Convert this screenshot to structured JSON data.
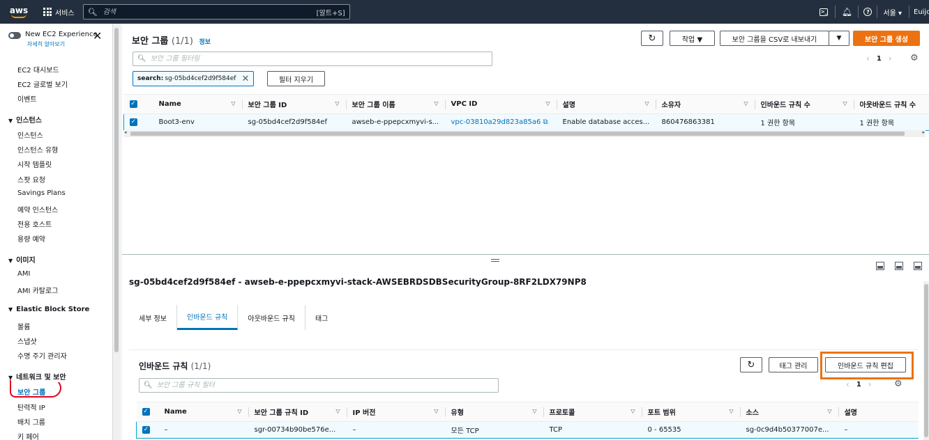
{
  "topnav": {
    "logo": "aws",
    "services": "서비스",
    "search_placeholder": "검색",
    "search_shortcut": "[알트+S]",
    "region": "서울 ▾",
    "user": "Euijo",
    "icons": [
      "cloudshell-icon",
      "bell-icon",
      "help-icon"
    ]
  },
  "sidebar": {
    "new_experience": "New EC2 Experience",
    "learn_more": "자세히 알아보기",
    "items_top": [
      "EC2 대시보드",
      "EC2 글로벌 보기",
      "이벤트"
    ],
    "sections": [
      {
        "title": "인스턴스",
        "items": [
          "인스턴스",
          "인스턴스 유형",
          "시작 템플릿",
          "스팟 요청",
          "Savings Plans",
          "예약 인스턴스",
          "전용 호스트",
          "용량 예약"
        ]
      },
      {
        "title": "이미지",
        "items": [
          "AMI",
          "AMI 카탈로그"
        ]
      },
      {
        "title": "Elastic Block Store",
        "items": [
          "볼륨",
          "스냅샷",
          "수명 주기 관리자"
        ]
      },
      {
        "title": "네트워크 및 보안",
        "items": [
          "보안 그룹",
          "탄력적 IP",
          "배치 그룹",
          "키 페어"
        ]
      }
    ],
    "active_item": "보안 그룹"
  },
  "top_panel": {
    "title": "보안 그룹",
    "count": "(1/1)",
    "info": "정보",
    "buttons": {
      "actions": "작업 ▼",
      "export": "보안 그룹을 CSV로 내보내기",
      "create": "보안 그룹 생성",
      "clear_filter": "필터 지우기"
    },
    "filter_placeholder": "보안 그룹 필터링",
    "token_label": "search:",
    "token_value": "sg-05bd4cef2d9f584ef",
    "page": "1",
    "columns": [
      "Name",
      "보안 그룹 ID",
      "보안 그룹 이름",
      "VPC ID",
      "설명",
      "소유자",
      "인바운드 규칙 수",
      "아웃바운드 규칙 수"
    ],
    "rows": [
      {
        "name": "Boot3-env",
        "sg_id": "sg-05bd4cef2d9f584ef",
        "sg_name": "awseb-e-ppepcxmyvi-s...",
        "vpc_id": "vpc-03810a29d823a85a6",
        "desc": "Enable database acces...",
        "owner": "860476863381",
        "inbound": "1 권한 항목",
        "outbound": "1 권한 항목"
      }
    ]
  },
  "detail": {
    "title": "sg-05bd4cef2d9f584ef - awseb-e-ppepcxmyvi-stack-AWSEBRDSDBSecurityGroup-8RF2LDX79NP8",
    "tabs": [
      "세부 정보",
      "인바운드 규칙",
      "아웃바운드 규칙",
      "태그"
    ],
    "active_tab": "인바운드 규칙",
    "inbound_title": "인바운드 규칙",
    "inbound_count": "(1/1)",
    "buttons": {
      "manage_tags": "태그 관리",
      "edit_inbound": "인바운드 규칙 편집"
    },
    "filter_placeholder": "보안 그룹 규칙 필터",
    "page": "1",
    "columns": [
      "Name",
      "보안 그룹 규칙 ID",
      "IP 버전",
      "유형",
      "프로토콜",
      "포트 범위",
      "소스",
      "설명"
    ],
    "rows": [
      {
        "name": "–",
        "rule_id": "sgr-00734b90be576e...",
        "ip_version": "–",
        "type": "모든 TCP",
        "protocol": "TCP",
        "port_range": "0 - 65535",
        "source": "sg-0c9d4b50377007e...",
        "desc": "–"
      }
    ]
  },
  "colors": {
    "accent": "#0073bb",
    "primary_button": "#ec7211",
    "topnav": "#232f3e",
    "highlight_box": "#ec7211",
    "annotation": "#e3001b"
  }
}
